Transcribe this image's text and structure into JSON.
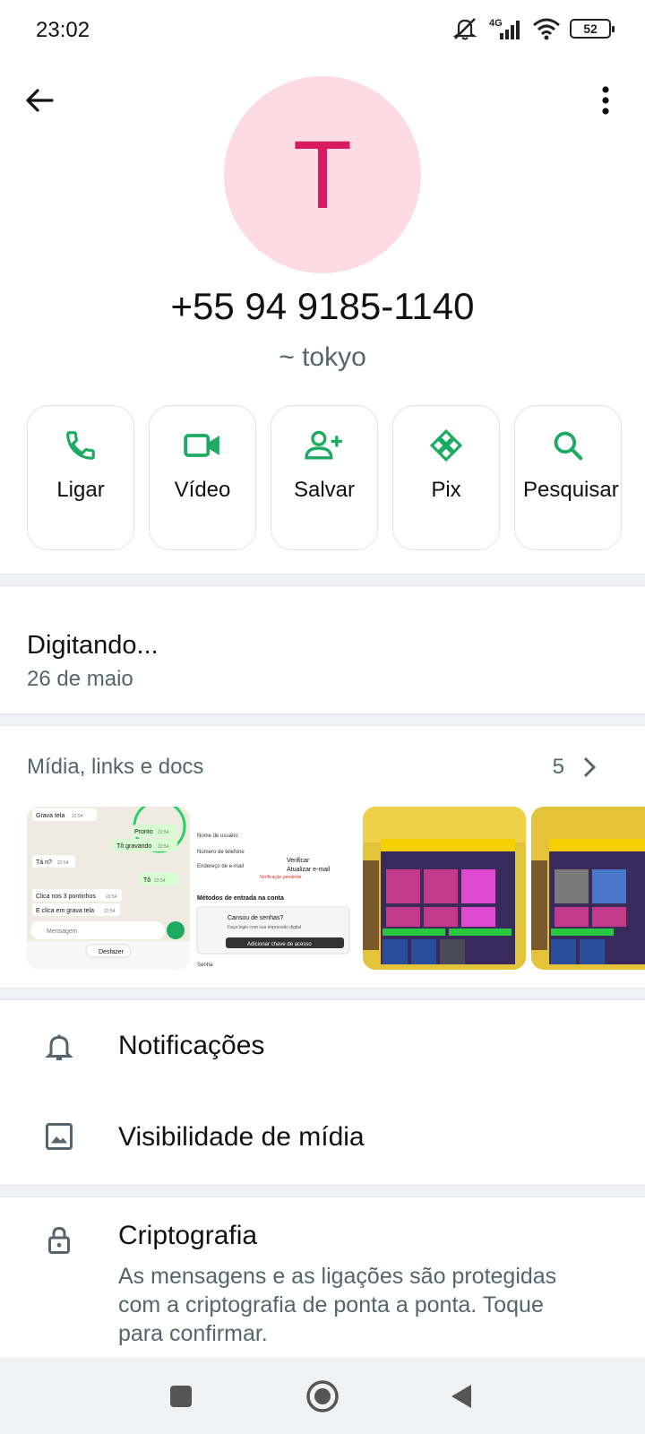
{
  "status_bar": {
    "time": "23:02",
    "network": "4G",
    "battery": "52"
  },
  "contact": {
    "avatar_letter": "T",
    "phone": "+55 94 9185-1140",
    "name": "~ tokyo"
  },
  "actions": [
    {
      "label": "Ligar",
      "icon": "phone-icon"
    },
    {
      "label": "Vídeo",
      "icon": "video-icon"
    },
    {
      "label": "Salvar",
      "icon": "add-person-icon"
    },
    {
      "label": "Pix",
      "icon": "pix-icon"
    },
    {
      "label": "Pesquisar",
      "icon": "search-icon"
    }
  ],
  "about": {
    "status": "Digitando...",
    "date": "26 de maio"
  },
  "media": {
    "title": "Mídia, links e docs",
    "count": "5",
    "thumb1": {
      "msg1": "Grava tela",
      "msg1_time": "22:54",
      "pronto": "Pronto",
      "pronto_time": "22:54",
      "gravando": "Tô gravando",
      "gravando_time": "22:54",
      "tan": "Tá n?",
      "tan_time": "22:54",
      "to": "Tô",
      "to_time": "22:54",
      "clica1": "Clica nos 3 pontinhos",
      "clica1_time": "22:54",
      "clica2": "E clica em grava tela",
      "clica2_time": "22:54",
      "input_placeholder": "Mensagem",
      "undo": "Desfazer"
    },
    "thumb2": {
      "line1": "Nome de usuário",
      "line2": "Número de telefone",
      "line3": "Endereço de e-mail",
      "verify": "Verificar",
      "update_email": "Atualizar e-mail",
      "pending": "Verificação pendente",
      "section": "Métodos de entrada na conta",
      "tired": "Cansou de senhas?",
      "tired_desc": "Faça login com sua impressão digital",
      "add_key": "Adicionar chave de acesso",
      "password": "Senha"
    }
  },
  "settings": {
    "notifications": "Notificações",
    "media_visibility": "Visibilidade de mídia",
    "encryption": "Criptografia",
    "encryption_desc": "As mensagens e as ligações são protegidas com a criptografia de ponta a ponta. Toque para confirmar."
  },
  "colors": {
    "accent": "#1daa61",
    "avatar_bg": "#fcdbe5",
    "avatar_fg": "#d81b60"
  }
}
